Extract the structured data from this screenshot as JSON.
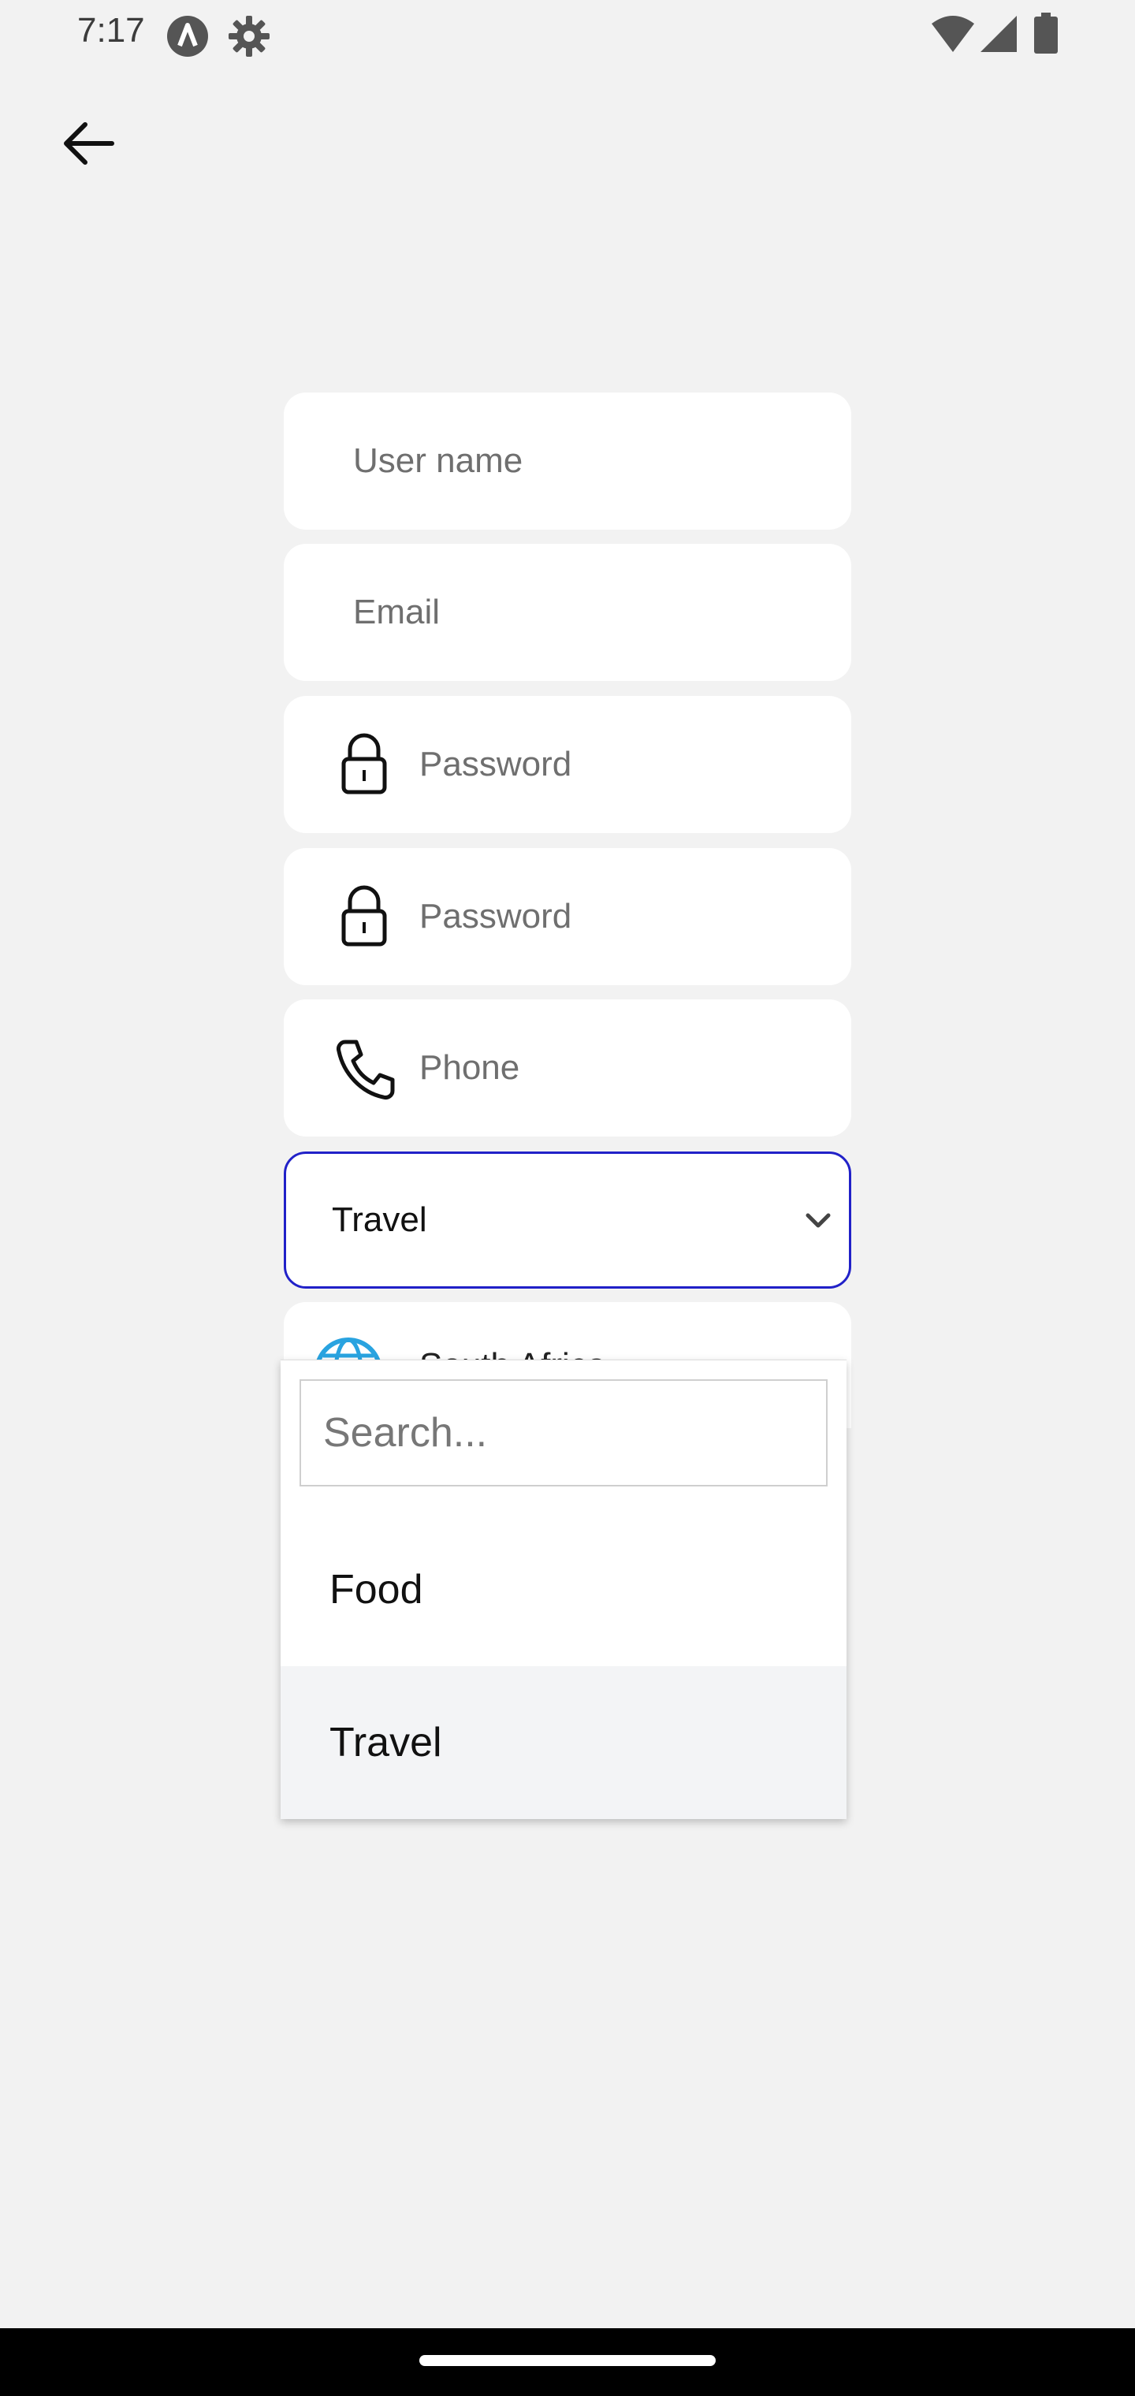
{
  "status_bar": {
    "time": "7:17",
    "icons": [
      "a-badge-icon",
      "settings-gear-icon",
      "wifi-icon",
      "cell-signal-icon",
      "battery-icon"
    ]
  },
  "header": {
    "back_icon": "arrow-left-icon"
  },
  "form": {
    "username_placeholder": "User name",
    "email_placeholder": "Email",
    "password_placeholder": "Password",
    "confirm_password_placeholder": "Password",
    "phone_placeholder": "Phone",
    "category_select_value": "Travel",
    "partial_field_text": "South Africa"
  },
  "dropdown": {
    "search_placeholder": "Search...",
    "options": [
      "Food",
      "Travel"
    ],
    "selected": "Travel"
  },
  "colors": {
    "background": "#f2f2f2",
    "field_background": "#ffffff",
    "focus_border": "#2121c8",
    "globe_icon": "#29a3e0",
    "selected_option_bg": "#f3f4f6"
  }
}
